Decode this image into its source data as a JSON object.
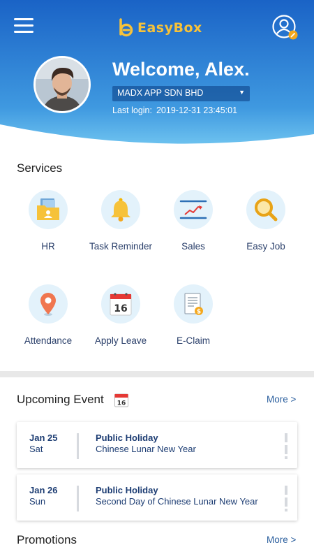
{
  "header": {
    "logo_text": "EasyBox",
    "welcome": "Welcome, Alex.",
    "company": "MADX APP SDN BHD",
    "last_login_label": "Last login:",
    "last_login_value": "2019-12-31 23:45:01",
    "colors": {
      "gradient_top": "#1a63c6",
      "gradient_bottom": "#5fb8ec",
      "logo": "#f6c23a"
    }
  },
  "services": {
    "title": "Services",
    "items": [
      {
        "label": "HR",
        "icon": "hr-folder-icon"
      },
      {
        "label": "Task Reminder",
        "icon": "bell-icon"
      },
      {
        "label": "Sales",
        "icon": "sales-chart-icon"
      },
      {
        "label": "Easy Job",
        "icon": "magnifier-icon"
      },
      {
        "label": "Attendance",
        "icon": "location-pin-icon"
      },
      {
        "label": "Apply Leave",
        "icon": "calendar-icon",
        "icon_text": "16"
      },
      {
        "label": "E-Claim",
        "icon": "claim-document-icon"
      }
    ]
  },
  "upcoming": {
    "title": "Upcoming Event",
    "calendar_day": "16",
    "more": "More >",
    "events": [
      {
        "date": "Jan 25",
        "day": "Sat",
        "type": "Public Holiday",
        "name": "Chinese Lunar New Year"
      },
      {
        "date": "Jan 26",
        "day": "Sun",
        "type": "Public Holiday",
        "name": "Second Day of Chinese Lunar New Year"
      }
    ]
  },
  "promotions": {
    "title": "Promotions",
    "more": "More >"
  }
}
